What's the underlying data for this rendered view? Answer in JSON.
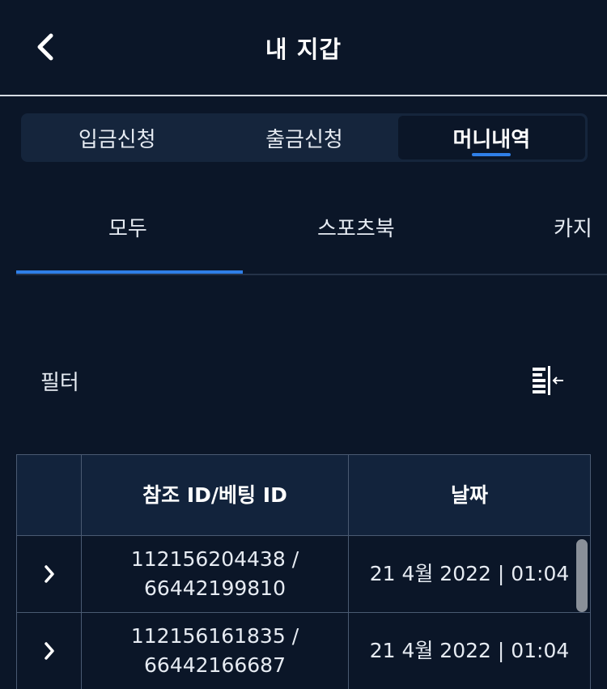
{
  "header": {
    "title": "내 지갑",
    "back_icon": "chevron-left-icon"
  },
  "wallet_tabs": [
    {
      "label": "입금신청",
      "active": false
    },
    {
      "label": "출금신청",
      "active": false
    },
    {
      "label": "머니내역",
      "active": true
    }
  ],
  "sub_tabs": [
    {
      "label": "모두",
      "active": true
    },
    {
      "label": "스포츠북",
      "active": false
    },
    {
      "label": "카지",
      "active": false
    }
  ],
  "filter": {
    "label": "필터",
    "icon": "filter-sort-icon"
  },
  "table": {
    "columns": [
      "",
      "참조 ID/베팅 ID",
      "날짜"
    ],
    "rows": [
      {
        "ref_id": "112156204438 /",
        "bet_id": "66442199810",
        "date": "21 4월 2022 | 01:04"
      },
      {
        "ref_id": "112156161835 /",
        "bet_id": "66442166687",
        "date": "21 4월 2022 | 01:04"
      }
    ]
  },
  "colors": {
    "background": "#0b1628",
    "accent": "#2f7fe8",
    "panel": "#15253c",
    "table_header": "#12233c"
  }
}
